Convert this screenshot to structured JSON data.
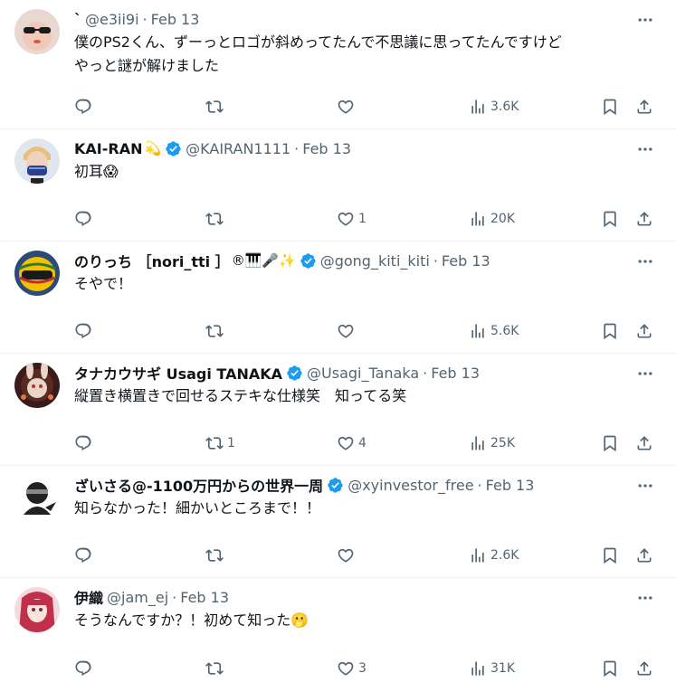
{
  "tweets": [
    {
      "name": "`",
      "emoji": "",
      "verified": false,
      "handle": "@e3ii9i",
      "date": "Feb 13",
      "text": "僕のPS2くん、ずーっとロゴが斜めってたんで不思議に思ってたんですけど\nやっと謎が解けました",
      "replies": "",
      "retweets": "",
      "likes": "",
      "views": "3.6K",
      "avatar_bg": "#e8d8d0",
      "avatar_fg": "#1a1a1a"
    },
    {
      "name": "KAI-RAN",
      "emoji": "💫",
      "verified": true,
      "handle": "@KAIRAN1111",
      "date": "Feb 13",
      "text": "初耳😱",
      "replies": "",
      "retweets": "",
      "likes": "1",
      "views": "20K",
      "avatar_bg": "#dfe6ef",
      "avatar_fg": "#2a3f8f"
    },
    {
      "name": "のりっち ［nori_tti ］",
      "emoji": "®🎹🎤✨",
      "verified": true,
      "handle": "@gong_kiti_kiti",
      "date": "Feb 13",
      "text": "そやで！",
      "replies": "",
      "retweets": "",
      "likes": "",
      "views": "5.6K",
      "avatar_bg": "#2b4a7a",
      "avatar_fg": "#f2c200"
    },
    {
      "name": "タナカウサギ Usagi TANAKA",
      "emoji": "",
      "verified": true,
      "handle": "@Usagi_Tanaka",
      "date": "Feb 13",
      "text": "縦置き横置きで回せるステキな仕様笑　知ってる笑",
      "replies": "",
      "retweets": "1",
      "likes": "4",
      "views": "25K",
      "avatar_bg": "#3a1a1a",
      "avatar_fg": "#e07a3a"
    },
    {
      "name": "ざいさる@-1100万円からの世界一周",
      "emoji": "",
      "verified": true,
      "handle": "@xyinvestor_free",
      "date": "Feb 13",
      "text": "知らなかった！細かいところまで！！",
      "replies": "",
      "retweets": "",
      "likes": "",
      "views": "2.6K",
      "avatar_bg": "#ffffff",
      "avatar_fg": "#222222"
    },
    {
      "name": "伊織",
      "emoji": "",
      "verified": false,
      "handle": "@jam_ej",
      "date": "Feb 13",
      "text": "そうなんですか？！初めて知った🫢",
      "replies": "",
      "retweets": "",
      "likes": "3",
      "views": "31K",
      "avatar_bg": "#f4d9e0",
      "avatar_fg": "#c0304a"
    }
  ],
  "colors": {
    "text": "#0f1419",
    "secondary": "#536471",
    "verified": "#1d9bf0",
    "divider": "#eff3f4"
  },
  "icons": {
    "reply": "reply-icon",
    "retweet": "retweet-icon",
    "like": "heart-icon",
    "views": "views-chart-icon",
    "bookmark": "bookmark-icon",
    "share": "share-icon",
    "more": "more-icon",
    "verified": "verified-badge-icon"
  }
}
